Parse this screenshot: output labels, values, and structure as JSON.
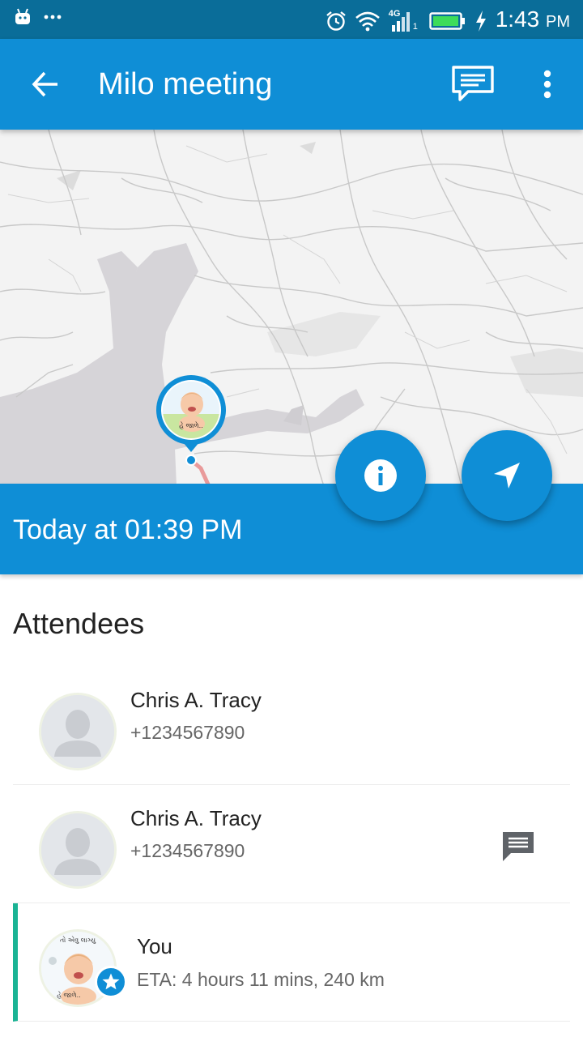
{
  "status_bar": {
    "time": "1:43",
    "ampm": "PM",
    "network": "4G",
    "sim": "1",
    "icons": [
      "android-icon",
      "more-notifications-icon",
      "alarm-icon",
      "wifi-icon",
      "signal-icon",
      "battery-icon",
      "charging-icon"
    ]
  },
  "app_bar": {
    "title": "Milo meeting",
    "icons": [
      "back-arrow-icon",
      "chat-icon",
      "more-vert-icon"
    ],
    "accent_color": "#0f8ed6"
  },
  "map": {
    "marker_caption": "હે જાળે..",
    "marker_border_color": "#0f8ed6",
    "route_color": "#e99a9a"
  },
  "meeting": {
    "time_label": "Today at 01:39 PM",
    "fab_icons": [
      "info-icon",
      "navigation-icon"
    ]
  },
  "attendees": {
    "heading": "Attendees",
    "list": [
      {
        "name": "Chris A. Tracy",
        "detail": "+1234567890",
        "avatar": "default-person-icon",
        "has_message": false
      },
      {
        "name": "Chris A. Tracy",
        "detail": "+1234567890",
        "avatar": "default-person-icon",
        "has_message": true
      },
      {
        "name": "You",
        "detail": "ETA: 4 hours 11 mins, 240 km",
        "avatar": "baby-photo",
        "badge": "star-icon",
        "highlight_color": "#1ab394"
      }
    ],
    "avatar_text": {
      "top": "તો એવુ લાગ્યુ",
      "bottom": "હે જાળે.."
    }
  }
}
